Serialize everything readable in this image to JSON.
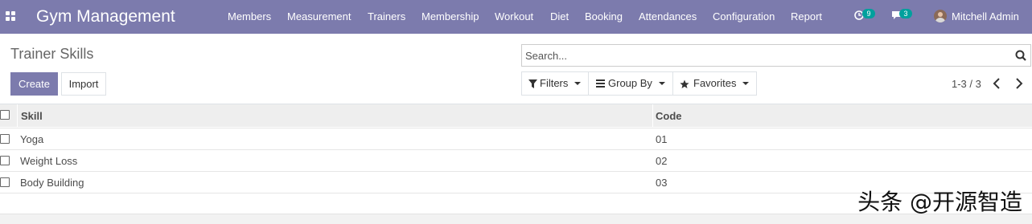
{
  "app": {
    "title": "Gym Management",
    "accent_color": "#7c7bad"
  },
  "navbar": {
    "apps_icon": "grid-icon",
    "menu": [
      {
        "label": "Members"
      },
      {
        "label": "Measurement"
      },
      {
        "label": "Trainers"
      },
      {
        "label": "Membership"
      },
      {
        "label": "Workout"
      },
      {
        "label": "Diet"
      },
      {
        "label": "Booking"
      },
      {
        "label": "Attendances"
      },
      {
        "label": "Configuration"
      },
      {
        "label": "Report"
      }
    ],
    "activity_count": "9",
    "messages_count": "3",
    "user_name": "Mitchell Admin",
    "badge_color": "#00a09d"
  },
  "control_panel": {
    "breadcrumb": "Trainer Skills",
    "create_label": "Create",
    "import_label": "Import",
    "search_placeholder": "Search...",
    "filters_label": "Filters",
    "groupby_label": "Group By",
    "favorites_label": "Favorites",
    "pager_value": "1-3 / 3"
  },
  "list": {
    "columns": [
      "Skill",
      "Code"
    ],
    "rows": [
      {
        "skill": "Yoga",
        "code": "01"
      },
      {
        "skill": "Weight Loss",
        "code": "02"
      },
      {
        "skill": "Body Building",
        "code": "03"
      }
    ]
  },
  "watermark": "头条 @开源智造"
}
